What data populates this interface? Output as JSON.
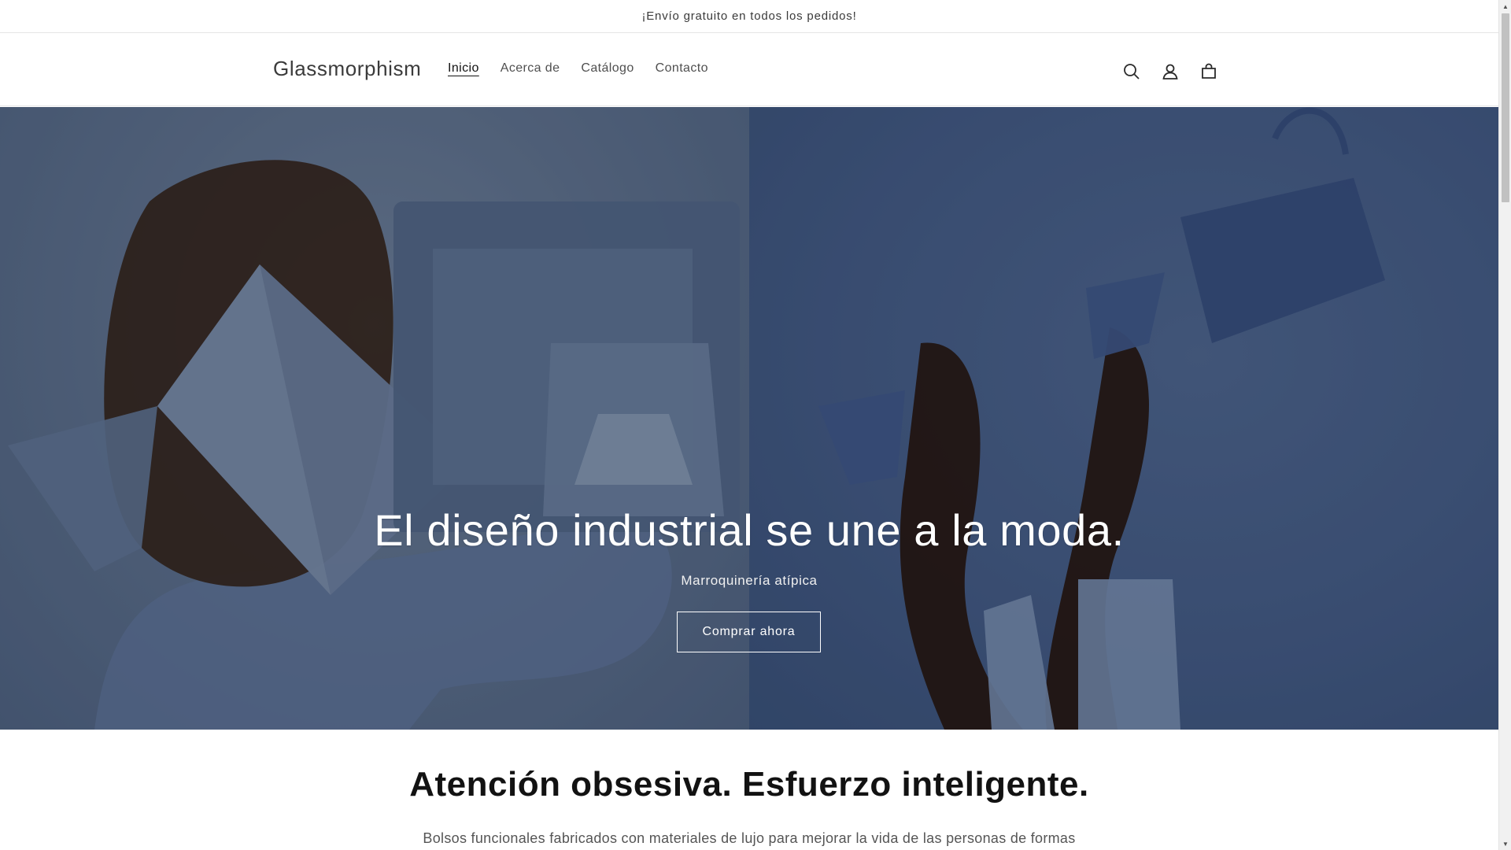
{
  "announcement": {
    "text": "¡Envío gratuito en todos los pedidos!"
  },
  "header": {
    "logo": "Glassmorphism",
    "nav": [
      {
        "label": "Inicio",
        "active": true
      },
      {
        "label": "Acerca de",
        "active": false
      },
      {
        "label": "Catálogo",
        "active": false
      },
      {
        "label": "Contacto",
        "active": false
      }
    ],
    "icons": [
      "search-icon",
      "account-icon",
      "cart-icon"
    ]
  },
  "hero": {
    "title": "El diseño industrial se une a la moda.",
    "subtitle": "Marroquinería atípica",
    "button_label": "Comprar ahora"
  },
  "intro": {
    "title": "Atención obsesiva. Esfuerzo inteligente.",
    "text": "Bolsos funcionales fabricados con materiales de lujo para mejorar la vida de las personas de formas"
  },
  "colors": {
    "hero_left": "#6d83a5",
    "hero_right": "#4f6a9c",
    "text": "#121212"
  }
}
